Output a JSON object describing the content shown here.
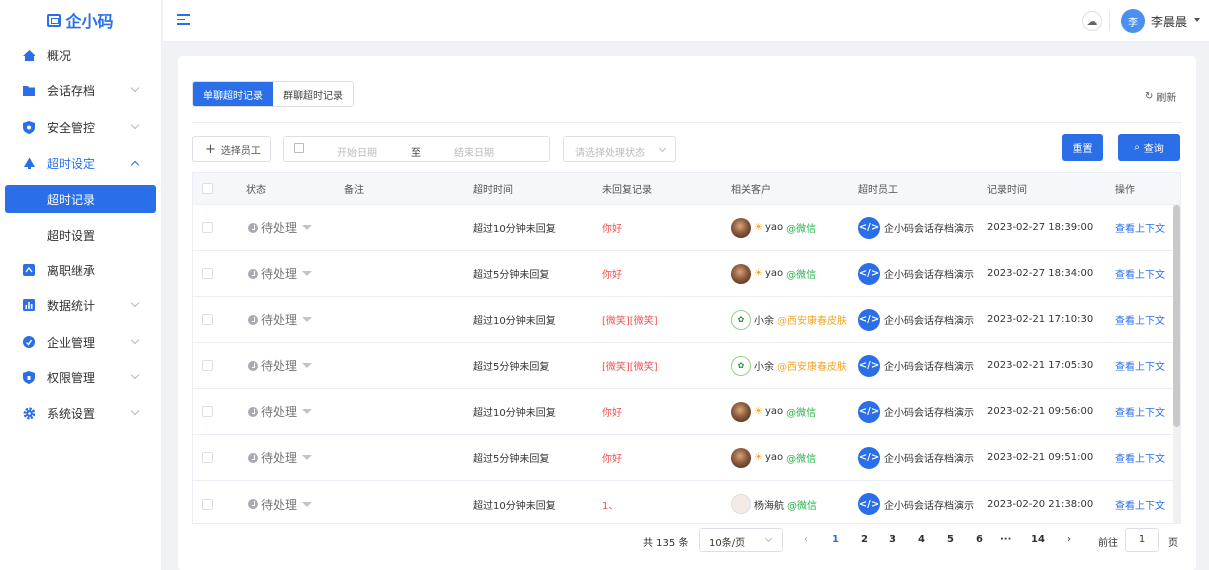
{
  "app": {
    "logo_text": "企小码"
  },
  "sidebar": {
    "items": [
      {
        "label": "概况"
      },
      {
        "label": "会话存档"
      },
      {
        "label": "安全管控"
      },
      {
        "label": "超时设定"
      },
      {
        "label": "超时记录"
      },
      {
        "label": "超时设置"
      },
      {
        "label": "离职继承"
      },
      {
        "label": "数据统计"
      },
      {
        "label": "企业管理"
      },
      {
        "label": "权限管理"
      },
      {
        "label": "系统设置"
      }
    ]
  },
  "header": {
    "user_initial": "李",
    "user_name": "李晨晨"
  },
  "tabs": [
    {
      "label": "单聊超时记录"
    },
    {
      "label": "群聊超时记录"
    }
  ],
  "refresh_label": "刷新",
  "filters": {
    "select_staff": "选择员工",
    "start_placeholder": "开始日期",
    "range_separator": "至",
    "end_placeholder": "结束日期",
    "status_placeholder": "请选择处理状态",
    "reset": "重置",
    "query": "查询"
  },
  "table": {
    "columns": [
      "状态",
      "备注",
      "超时时间",
      "未回复记录",
      "相关客户",
      "超时员工",
      "记录时间",
      "操作"
    ],
    "rows": [
      {
        "status": "待处理",
        "timeout": "超过10分钟未回复",
        "unreplied": "你好",
        "customer_name": "yao",
        "customer_tag": "@微信",
        "staff": "企小码会话存档演示",
        "time": "2023-02-27 18:39:00",
        "action": "查看上下文"
      },
      {
        "status": "待处理",
        "timeout": "超过5分钟未回复",
        "unreplied": "你好",
        "customer_name": "yao",
        "customer_tag": "@微信",
        "staff": "企小码会话存档演示",
        "time": "2023-02-27 18:34:00",
        "action": "查看上下文"
      },
      {
        "status": "待处理",
        "timeout": "超过10分钟未回复",
        "unreplied": "[微笑][微笑]",
        "customer_name": "小余",
        "customer_tag": "@西安康春皮肤",
        "staff": "企小码会话存档演示",
        "time": "2023-02-21 17:10:30",
        "action": "查看上下文"
      },
      {
        "status": "待处理",
        "timeout": "超过5分钟未回复",
        "unreplied": "[微笑][微笑]",
        "customer_name": "小余",
        "customer_tag": "@西安康春皮肤",
        "staff": "企小码会话存档演示",
        "time": "2023-02-21 17:05:30",
        "action": "查看上下文"
      },
      {
        "status": "待处理",
        "timeout": "超过10分钟未回复",
        "unreplied": "你好",
        "customer_name": "yao",
        "customer_tag": "@微信",
        "staff": "企小码会话存档演示",
        "time": "2023-02-21 09:56:00",
        "action": "查看上下文"
      },
      {
        "status": "待处理",
        "timeout": "超过5分钟未回复",
        "unreplied": "你好",
        "customer_name": "yao",
        "customer_tag": "@微信",
        "staff": "企小码会话存档演示",
        "time": "2023-02-21 09:51:00",
        "action": "查看上下文"
      },
      {
        "status": "待处理",
        "timeout": "超过10分钟未回复",
        "unreplied": "1、",
        "customer_name": "杨海航",
        "customer_tag": "@微信",
        "staff": "企小码会话存档演示",
        "time": "2023-02-20 21:38:00",
        "action": "查看上下文"
      }
    ]
  },
  "pagination": {
    "total": "共 135 条",
    "page_size": "10条/页",
    "pages": [
      "1",
      "2",
      "3",
      "4",
      "5",
      "6",
      "···",
      "14"
    ],
    "goto_label": "前往",
    "goto_value": "1",
    "page_suffix": "页"
  },
  "colors": {
    "primary": "#2a6ee8",
    "danger": "#f0504f",
    "wechat": "#27b148",
    "orange": "#f5a623"
  }
}
